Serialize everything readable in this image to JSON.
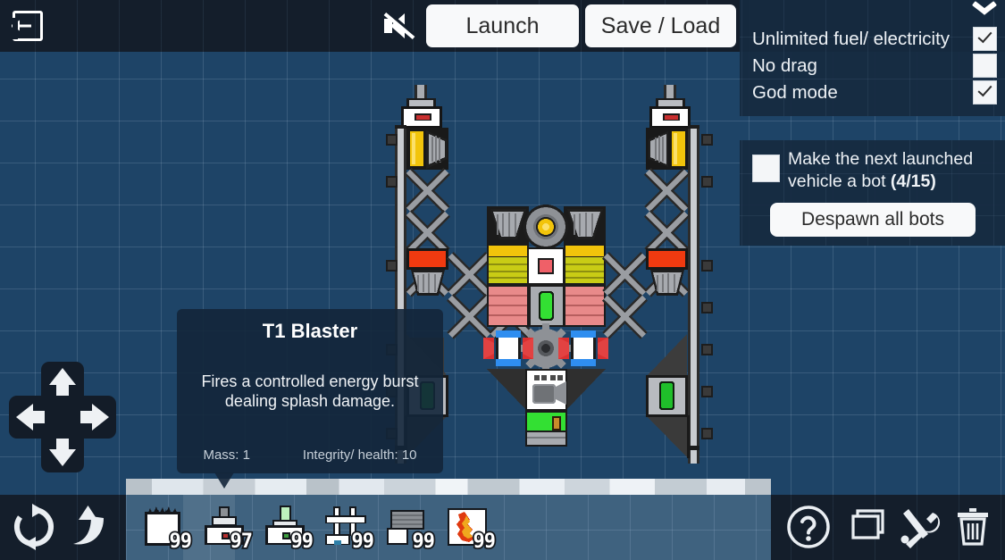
{
  "topbar": {
    "exit_label": "Exit",
    "mute_label": "Sound muted",
    "launch_label": "Launch",
    "saveload_label": "Save / Load"
  },
  "options_panel": {
    "collapse_label": "Collapse",
    "rows": [
      {
        "label": "Unlimited fuel/ electricity",
        "checked": true
      },
      {
        "label": "No drag",
        "checked": false
      },
      {
        "label": "God mode",
        "checked": true
      }
    ]
  },
  "bot_panel": {
    "checkbox_checked": false,
    "text_line1": "Make the next launched",
    "text_line2": "vehicle a bot ",
    "counter": "(4/15)",
    "despawn_label": "Despawn all bots"
  },
  "tooltip": {
    "title": "T1 Blaster",
    "description": "Fires a controlled energy burst dealing splash damage.",
    "mass_label": "Mass: 1",
    "integrity_label": "Integrity/ health: 10"
  },
  "dpad": {
    "up_label": "Pan up",
    "down_label": "Pan down",
    "left_label": "Pan left",
    "right_label": "Pan right"
  },
  "bottombar": {
    "left_buttons": [
      {
        "name": "rotate-icon",
        "label": "Rotate"
      },
      {
        "name": "flip-icon",
        "label": "Flip"
      }
    ],
    "parts": [
      {
        "name": "structure-block",
        "count": "99",
        "selected": false
      },
      {
        "name": "thruster-part",
        "count": "97",
        "selected": true
      },
      {
        "name": "battery-part",
        "count": "99",
        "selected": false
      },
      {
        "name": "connector-part",
        "count": "99",
        "selected": false
      },
      {
        "name": "plate-part",
        "count": "99",
        "selected": false
      },
      {
        "name": "explosive-part",
        "count": "99",
        "selected": false
      }
    ],
    "right_buttons": [
      {
        "name": "help-icon",
        "label": "Help"
      },
      {
        "name": "copy-icon",
        "label": "Copy"
      },
      {
        "name": "tools-icon",
        "label": "Tools"
      },
      {
        "name": "trash-icon",
        "label": "Delete"
      }
    ]
  },
  "colors": {
    "blueprint_bg": "#1e4467",
    "panel_bg": "#152a40",
    "bar_bg": "#141e2b",
    "accent_white": "#f8f9fa",
    "strip_bg": "#3f627f"
  }
}
